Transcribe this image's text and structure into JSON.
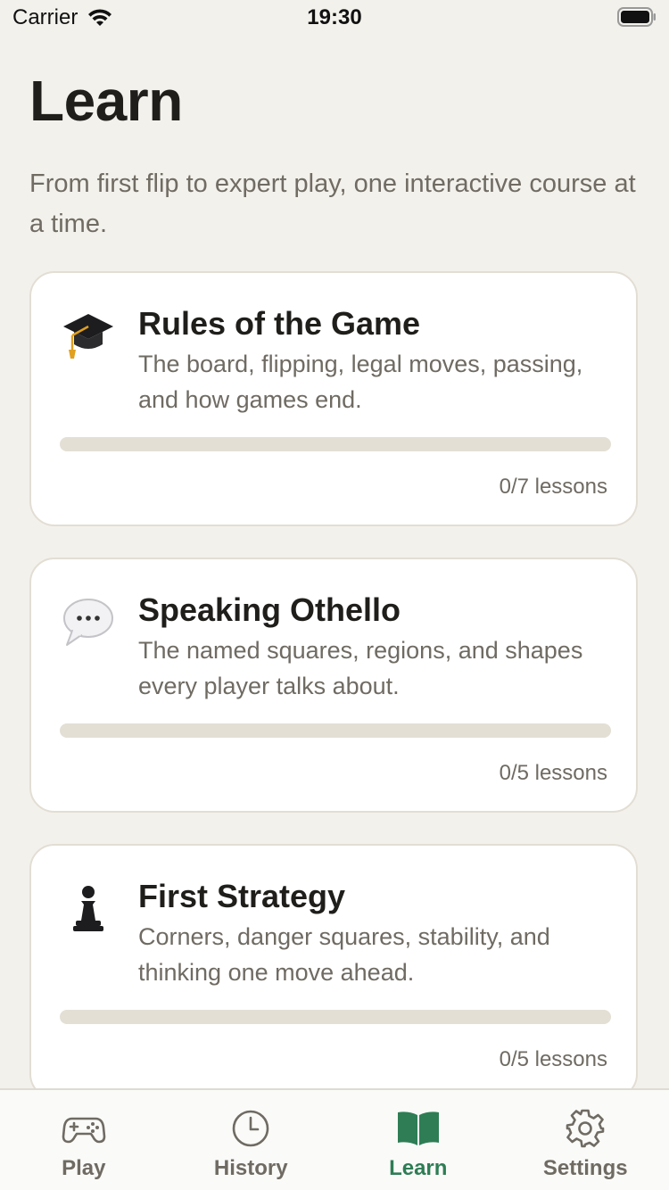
{
  "status_bar": {
    "carrier": "Carrier",
    "time": "19:30"
  },
  "header": {
    "title": "Learn",
    "subtitle": "From first flip to expert play, one interactive course at a time."
  },
  "courses": [
    {
      "icon": "graduation-cap-icon",
      "title": "Rules of the Game",
      "description": "The board, flipping, legal moves, passing, and how games end.",
      "progress": 0,
      "lessons": "0/7 lessons"
    },
    {
      "icon": "speech-bubble-icon",
      "title": "Speaking Othello",
      "description": "The named squares, regions, and shapes every player talks about.",
      "progress": 0,
      "lessons": "0/5 lessons"
    },
    {
      "icon": "chess-pawn-icon",
      "title": "First Strategy",
      "description": "Corners, danger squares, stability, and thinking one move ahead.",
      "progress": 0,
      "lessons": "0/5 lessons"
    }
  ],
  "tab_bar": {
    "tabs": [
      {
        "label": "Play",
        "icon": "gamepad-icon",
        "active": false
      },
      {
        "label": "History",
        "icon": "clock-icon",
        "active": false
      },
      {
        "label": "Learn",
        "icon": "book-icon",
        "active": true
      },
      {
        "label": "Settings",
        "icon": "gear-icon",
        "active": false
      }
    ]
  },
  "colors": {
    "background": "#f3f1ec",
    "accent": "#2e7d55",
    "card": "#ffffff",
    "track": "#e3dfd5"
  }
}
